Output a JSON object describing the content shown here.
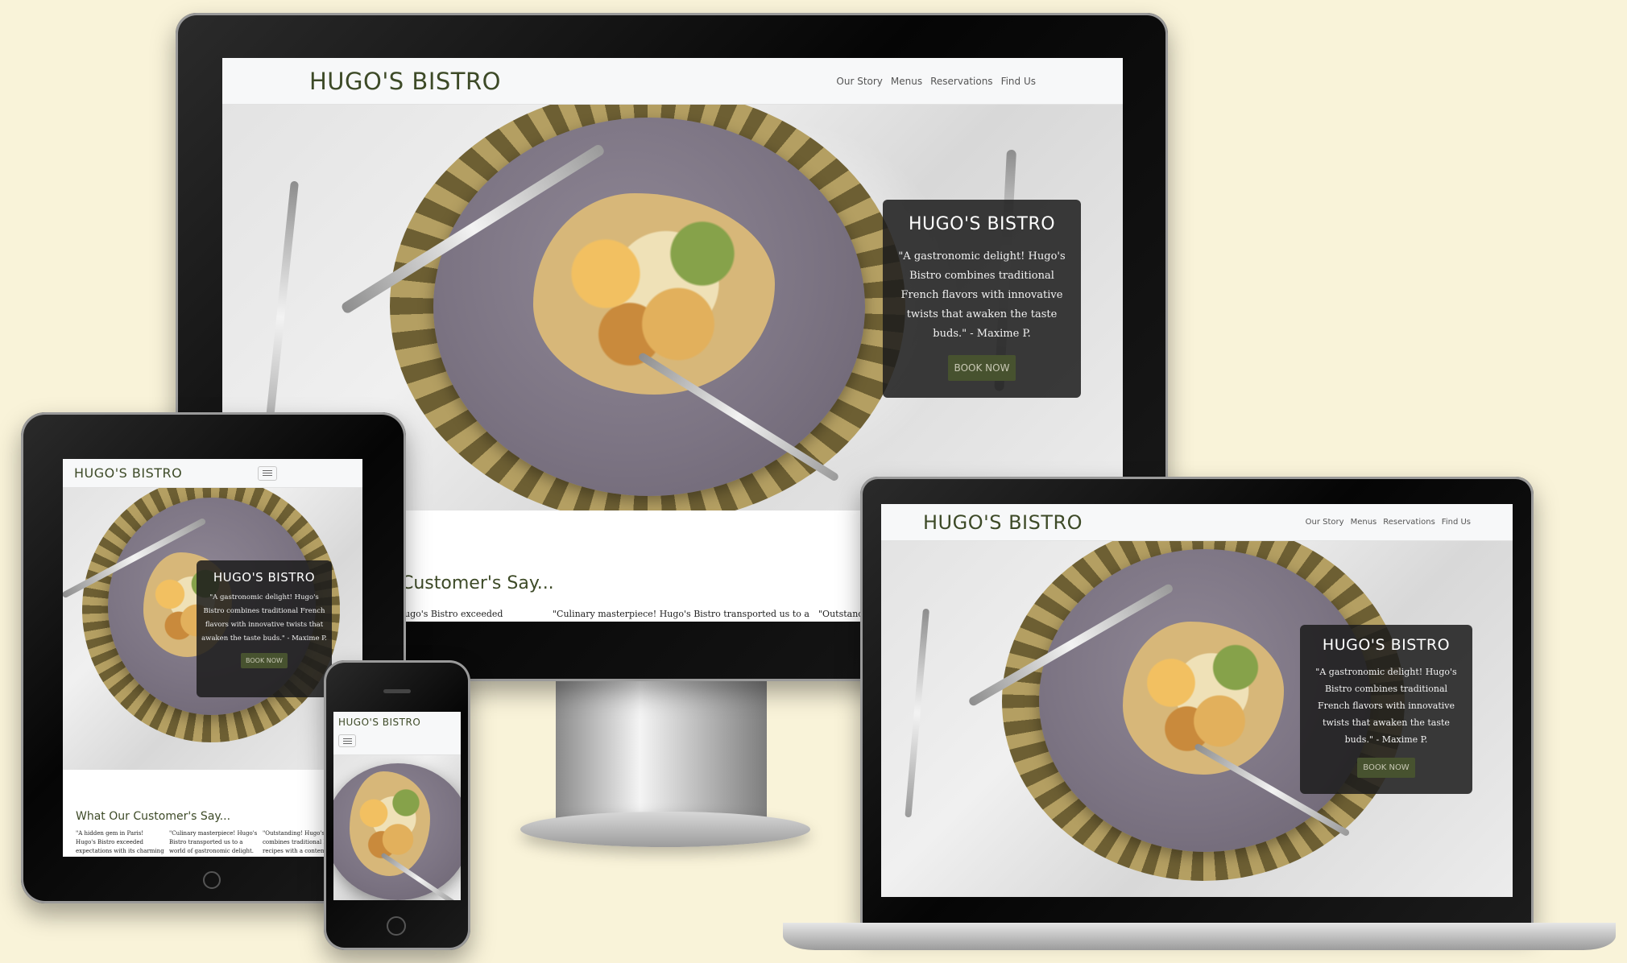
{
  "site": {
    "brand": "HUGO'S BISTRO",
    "nav": [
      "Our Story",
      "Menus",
      "Reservations",
      "Find Us"
    ],
    "hero_heading": "HUGO'S BISTRO",
    "hero_quote": "\"A gastronomic delight! Hugo's Bistro combines traditional French flavors with innovative twists that awaken the taste buds.\" - Maxime P.",
    "book_label": "BOOK NOW",
    "reviews_title_desktop": "Customer's Say...",
    "reviews_title_tablet": "What Our Customer's Say...",
    "reviews": [
      "\"A hidden gem in Paris! Hugo's Bistro exceeded expectations with its charming ambiance, delicious fusion...",
      "\"Culinary masterpiece! Hugo's Bistro transported us to a world of gastronomic delight. Exquisite flavors, artful...",
      "\"Outstanding! Hugo's Bistro combines traditional French recipes with a contemporary..."
    ],
    "desktop_review_snippets": [
      "ugo's Bistro exceeded",
      "\"Culinary masterpiece! Hugo's Bistro transported us to a",
      "\"Outstanding!"
    ]
  },
  "colors": {
    "background": "#f9f3d9",
    "brand_green": "#3d4a27",
    "button_green": "#47522f"
  }
}
